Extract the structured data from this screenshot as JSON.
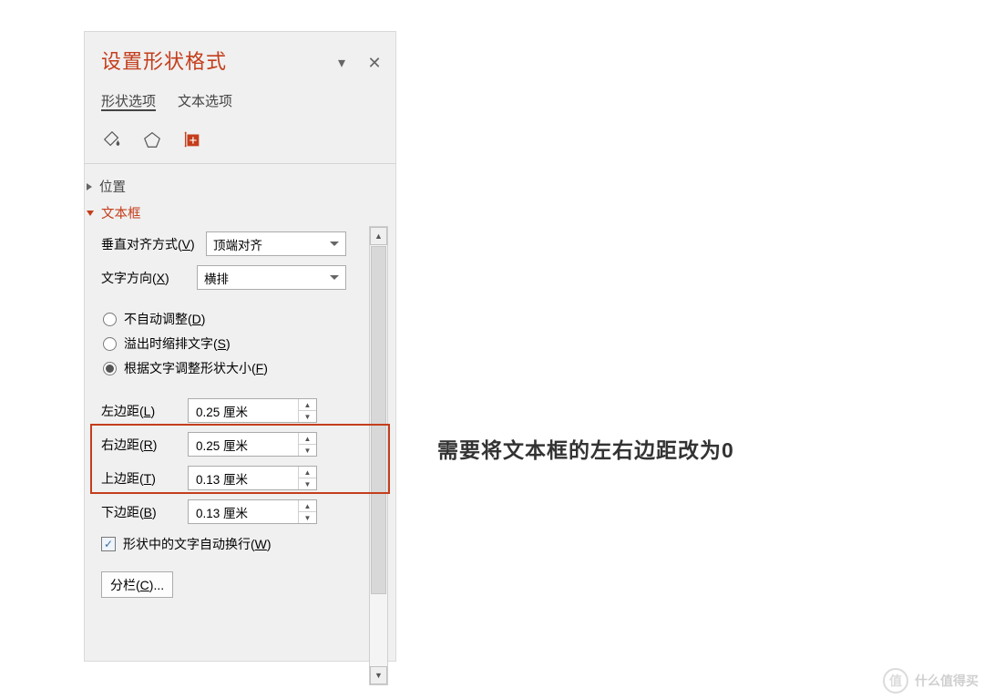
{
  "panel": {
    "title": "设置形状格式",
    "tabs": {
      "shape": "形状选项",
      "text": "文本选项"
    },
    "sections": {
      "position": "位置",
      "textbox": "文本框"
    },
    "vertical_align": {
      "label": "垂直对齐方式(",
      "hotkey": "V",
      "suffix": ")",
      "value": "顶端对齐"
    },
    "text_dir": {
      "label": "文字方向(",
      "hotkey": "X",
      "suffix": ")",
      "value": "横排"
    },
    "radios": {
      "no_adjust": {
        "label": "不自动调整(",
        "hotkey": "D",
        "suffix": ")"
      },
      "shrink": {
        "label": "溢出时缩排文字(",
        "hotkey": "S",
        "suffix": ")"
      },
      "resize": {
        "label": "根据文字调整形状大小(",
        "hotkey": "F",
        "suffix": ")"
      }
    },
    "margins": {
      "left": {
        "label": "左边距(",
        "hotkey": "L",
        "suffix": ")",
        "value": "0.25 厘米"
      },
      "right": {
        "label": "右边距(",
        "hotkey": "R",
        "suffix": ")",
        "value": "0.25 厘米"
      },
      "top": {
        "label": "上边距(",
        "hotkey": "T",
        "suffix": ")",
        "value": "0.13 厘米"
      },
      "bottom": {
        "label": "下边距(",
        "hotkey": "B",
        "suffix": ")",
        "value": "0.13 厘米"
      }
    },
    "wrap": {
      "label": "形状中的文字自动换行(",
      "hotkey": "W",
      "suffix": ")"
    },
    "columns_btn": {
      "label": "分栏(",
      "hotkey": "C",
      "suffix": ")..."
    }
  },
  "annotation": "需要将文本框的左右边距改为0",
  "watermark": "什么值得买"
}
